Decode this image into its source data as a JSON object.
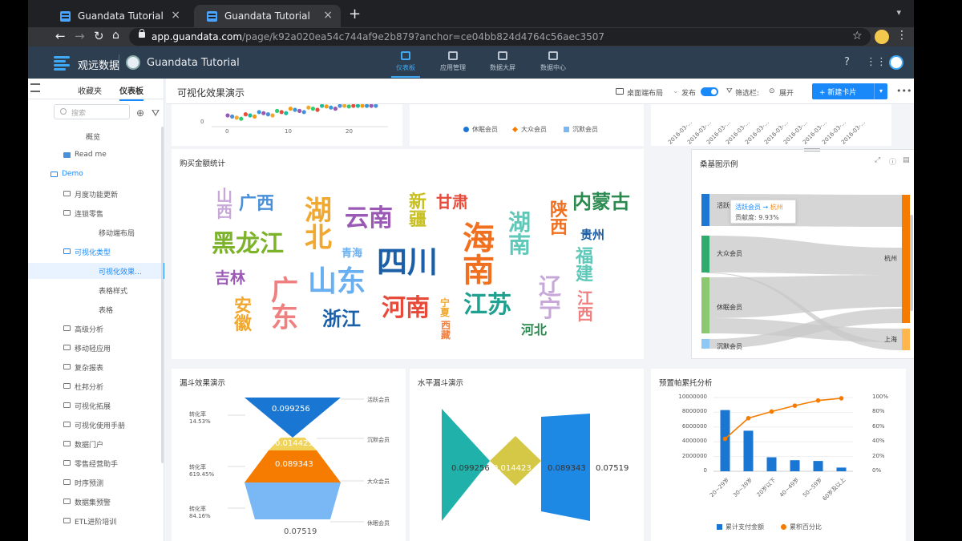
{
  "browser": {
    "tabs": [
      {
        "title": "Guandata Tutorial",
        "active": false
      },
      {
        "title": "Guandata Tutorial",
        "active": true
      }
    ],
    "url_domain": "app.guandata.com",
    "url_path": "/page/k92a020ea54c744af9e2b879?anchor=ce04bb824d4764c56aec3507"
  },
  "header": {
    "app_name": "观远数据",
    "page_title": "Guandata Tutorial",
    "nav": [
      {
        "label": "仪表板",
        "active": true
      },
      {
        "label": "应用管理",
        "active": false
      },
      {
        "label": "数据大屏",
        "active": false
      },
      {
        "label": "数据中心",
        "active": false
      }
    ]
  },
  "sidebar": {
    "tabs": [
      "收藏夹",
      "仪表板"
    ],
    "search_placeholder": "搜索",
    "items": [
      {
        "label": "概览",
        "level": 1,
        "type": "page"
      },
      {
        "label": "Read me",
        "level": 1,
        "type": "doc"
      },
      {
        "label": "Demo",
        "level": 0,
        "type": "folder"
      },
      {
        "label": "月度功能更新",
        "level": 1,
        "type": "folder"
      },
      {
        "label": "连锁零售",
        "level": 1,
        "type": "folder"
      },
      {
        "label": "移动端布局",
        "level": 2,
        "type": "page"
      },
      {
        "label": "可视化类型",
        "level": 1,
        "type": "folder"
      },
      {
        "label": "可视化效果…",
        "level": 2,
        "type": "page",
        "selected": true
      },
      {
        "label": "表格样式",
        "level": 2,
        "type": "page"
      },
      {
        "label": "表格",
        "level": 2,
        "type": "page"
      },
      {
        "label": "高级分析",
        "level": 1,
        "type": "folder"
      },
      {
        "label": "移动轻应用",
        "level": 1,
        "type": "folder"
      },
      {
        "label": "复杂报表",
        "level": 1,
        "type": "folder"
      },
      {
        "label": "杜邦分析",
        "level": 1,
        "type": "folder"
      },
      {
        "label": "可视化拓展",
        "level": 1,
        "type": "folder"
      },
      {
        "label": "可视化使用手册",
        "level": 1,
        "type": "folder"
      },
      {
        "label": "数据门户",
        "level": 1,
        "type": "folder"
      },
      {
        "label": "零售经营助手",
        "level": 1,
        "type": "folder"
      },
      {
        "label": "时序预测",
        "level": 1,
        "type": "folder"
      },
      {
        "label": "数据集预警",
        "level": 1,
        "type": "folder"
      },
      {
        "label": "ETL进阶培训",
        "level": 1,
        "type": "folder"
      }
    ]
  },
  "dashboard": {
    "title": "可视化效果演示",
    "toolbar": {
      "layout": "桌面端布局",
      "publish": "发布",
      "filter_bar": "筛选栏:",
      "expand": "展开",
      "new_card": "+ 新建卡片"
    },
    "top_cards": {
      "scatter_axis": {
        "y0": "0",
        "x": [
          "0",
          "10",
          "20"
        ]
      },
      "legend": [
        "休眠会员",
        "大众会员",
        "沉默会员"
      ],
      "dates": [
        "2016-03-...",
        "2016-03-...",
        "2016-03-...",
        "2016-03-...",
        "2016-03-...",
        "2016-03-...",
        "2016-03-...",
        "2016-03-...",
        "2016-03-...",
        "2016-03-..."
      ]
    },
    "wordcloud": {
      "title": "购买金额统计",
      "words": [
        {
          "text": "山西",
          "color": "#c7a8d8",
          "vertical": true
        },
        {
          "text": "广西",
          "color": "#4a90d9",
          "vertical": false
        },
        {
          "text": "黑龙江",
          "color": "#7cb32b",
          "vertical": false
        },
        {
          "text": "吉林",
          "color": "#9b59b6",
          "vertical": false
        },
        {
          "text": "安徽",
          "color": "#f0a830",
          "vertical": true
        },
        {
          "text": "湖北",
          "color": "#f0a830",
          "vertical": true
        },
        {
          "text": "广东",
          "color": "#f08080",
          "vertical": true
        },
        {
          "text": "山东",
          "color": "#6ab0f0",
          "vertical": false
        },
        {
          "text": "云南",
          "color": "#9b59b6",
          "vertical": false
        },
        {
          "text": "青海",
          "color": "#6ab0f0",
          "vertical": false
        },
        {
          "text": "浙江",
          "color": "#1a5fa8",
          "vertical": false
        },
        {
          "text": "新疆",
          "color": "#c8c020",
          "vertical": true
        },
        {
          "text": "四川",
          "color": "#1a5fa8",
          "vertical": false
        },
        {
          "text": "河南",
          "color": "#e84a3a",
          "vertical": false
        },
        {
          "text": "甘肃",
          "color": "#e84a3a",
          "vertical": false
        },
        {
          "text": "宁夏",
          "color": "#f0a830",
          "vertical": true
        },
        {
          "text": "西藏",
          "color": "#f08040",
          "vertical": true
        },
        {
          "text": "海南",
          "color": "#f07020",
          "vertical": true
        },
        {
          "text": "江苏",
          "color": "#20a090",
          "vertical": false
        },
        {
          "text": "湖南",
          "color": "#5fc8b8",
          "vertical": true
        },
        {
          "text": "陕西",
          "color": "#f07020",
          "vertical": true
        },
        {
          "text": "内蒙古",
          "color": "#2a8a50",
          "vertical": false
        },
        {
          "text": "贵州",
          "color": "#1a5fa8",
          "vertical": false
        },
        {
          "text": "辽宁",
          "color": "#c7a8d8",
          "vertical": true
        },
        {
          "text": "福建",
          "color": "#5fc8b8",
          "vertical": true
        },
        {
          "text": "江西",
          "color": "#f08080",
          "vertical": true
        },
        {
          "text": "河北",
          "color": "#2a8a50",
          "vertical": false
        }
      ]
    },
    "sankey": {
      "title": "桑基图示例",
      "left_nodes": [
        {
          "label": "活跃会员",
          "color": "#1f77d4"
        },
        {
          "label": "大众会员",
          "color": "#2eab6d"
        },
        {
          "label": "休眠会员",
          "color": "#8cc870"
        },
        {
          "label": "沉默会员",
          "color": "#8fc7f5"
        }
      ],
      "right_nodes": [
        {
          "label": "杭州",
          "color": "#f57c00"
        },
        {
          "label": "上海",
          "color": "#ffb74d"
        }
      ],
      "tooltip": {
        "source": "活跃会员",
        "target": "杭州",
        "arrow": "→",
        "value_label": "贡献度",
        "value": "9.93%"
      }
    },
    "funnel": {
      "title": "漏斗效果演示",
      "conversion_label": "转化率",
      "conversions": [
        "14.53%",
        "619.45%",
        "84.16%"
      ],
      "stages": [
        {
          "name": "活跃会员",
          "value": "0.099256",
          "color": "#1976d2"
        },
        {
          "name": "沉默会员",
          "value": "0.014423",
          "color": "#f0d35a"
        },
        {
          "name": "大众会员",
          "value": "0.089343",
          "color": "#f57c00"
        },
        {
          "name": "休眠会员",
          "value": "0.07519",
          "color": "#7ab8f5"
        }
      ]
    },
    "hfunnel": {
      "title": "水平漏斗演示",
      "values": [
        "0.099256",
        "0.014423",
        "0.089343",
        "0.07519"
      ],
      "colors": [
        "#20b2aa",
        "#d4c846",
        "#1e88e5"
      ]
    },
    "pareto": {
      "title": "预置帕累托分析",
      "left_ticks": [
        "10000000",
        "8000000",
        "6000000",
        "4000000",
        "2000000",
        "0"
      ],
      "right_ticks": [
        "100%",
        "80%",
        "60%",
        "40%",
        "20%",
        "0%"
      ],
      "legend_bar": "累计支付金额",
      "legend_line": "累积百分比",
      "bar_color": "#1976d2",
      "line_color": "#f57c00"
    }
  },
  "chart_data": {
    "type": "bar",
    "title": "预置帕累托分析",
    "categories": [
      "20~29岁",
      "30~39岁",
      "20岁以下",
      "40~49岁",
      "50~59岁",
      "60岁及以上"
    ],
    "series": [
      {
        "name": "累计支付金额",
        "type": "bar",
        "axis": "left",
        "values": [
          8300000,
          5500000,
          1900000,
          1500000,
          1400000,
          500000
        ]
      },
      {
        "name": "累积百分比",
        "type": "line",
        "axis": "right",
        "values": [
          0.44,
          0.72,
          0.81,
          0.89,
          0.96,
          0.99
        ]
      }
    ],
    "ylim_left": [
      0,
      10000000
    ],
    "ylim_right": [
      0,
      1
    ],
    "grid": true,
    "legend": "bottom"
  }
}
